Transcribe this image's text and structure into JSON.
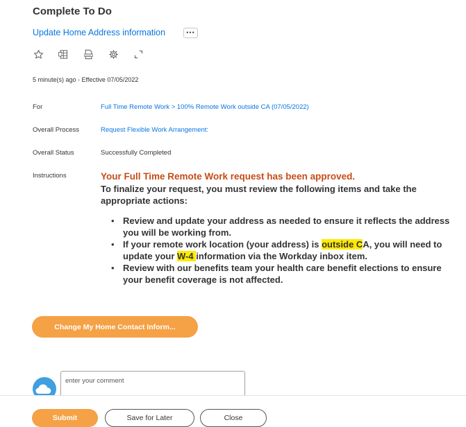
{
  "page": {
    "title": "Complete To Do",
    "subtitle": "Update Home Address information",
    "more_label": "•••",
    "meta": "5 minute(s) ago - Effective 07/05/2022"
  },
  "toolbar": {
    "icons": [
      "star-icon",
      "excel-icon",
      "pdf-icon",
      "settings-icon",
      "expand-icon"
    ]
  },
  "fields": {
    "for_label": "For",
    "for_value": "Full Time Remote Work > 100% Remote Work outside CA (07/05/2022)",
    "process_label": "Overall Process",
    "process_value": "Request Flexible Work Arrangement:",
    "status_label": "Overall Status",
    "status_value": "Successfully Completed",
    "instructions_label": "Instructions"
  },
  "instructions": {
    "heading": "Your Full Time Remote Work request has been approved.",
    "intro": "To finalize your request, you must review the following items and take the appropriate actions:",
    "item1": "Review and update your address as needed to ensure it reflects the address you will be working from.",
    "item2_a": "If your remote work location (your address) is ",
    "item2_hl1": "outside C",
    "item2_b": "A, you will need to update your ",
    "item2_hl2": "W-4 ",
    "item2_c": "information via the Workday inbox item.",
    "item3": "Review with our benefits team your health care benefit elections to ensure your benefit coverage is not affected."
  },
  "actions": {
    "change_contact": "Change My Home Contact Inform...",
    "comment_placeholder": "enter your comment",
    "submit": "Submit",
    "save_for_later": "Save for Later",
    "close": "Close"
  },
  "colors": {
    "accent": "#f5a146",
    "link": "#0875e1",
    "heading": "#c64c16",
    "highlight": "#ffea00"
  }
}
